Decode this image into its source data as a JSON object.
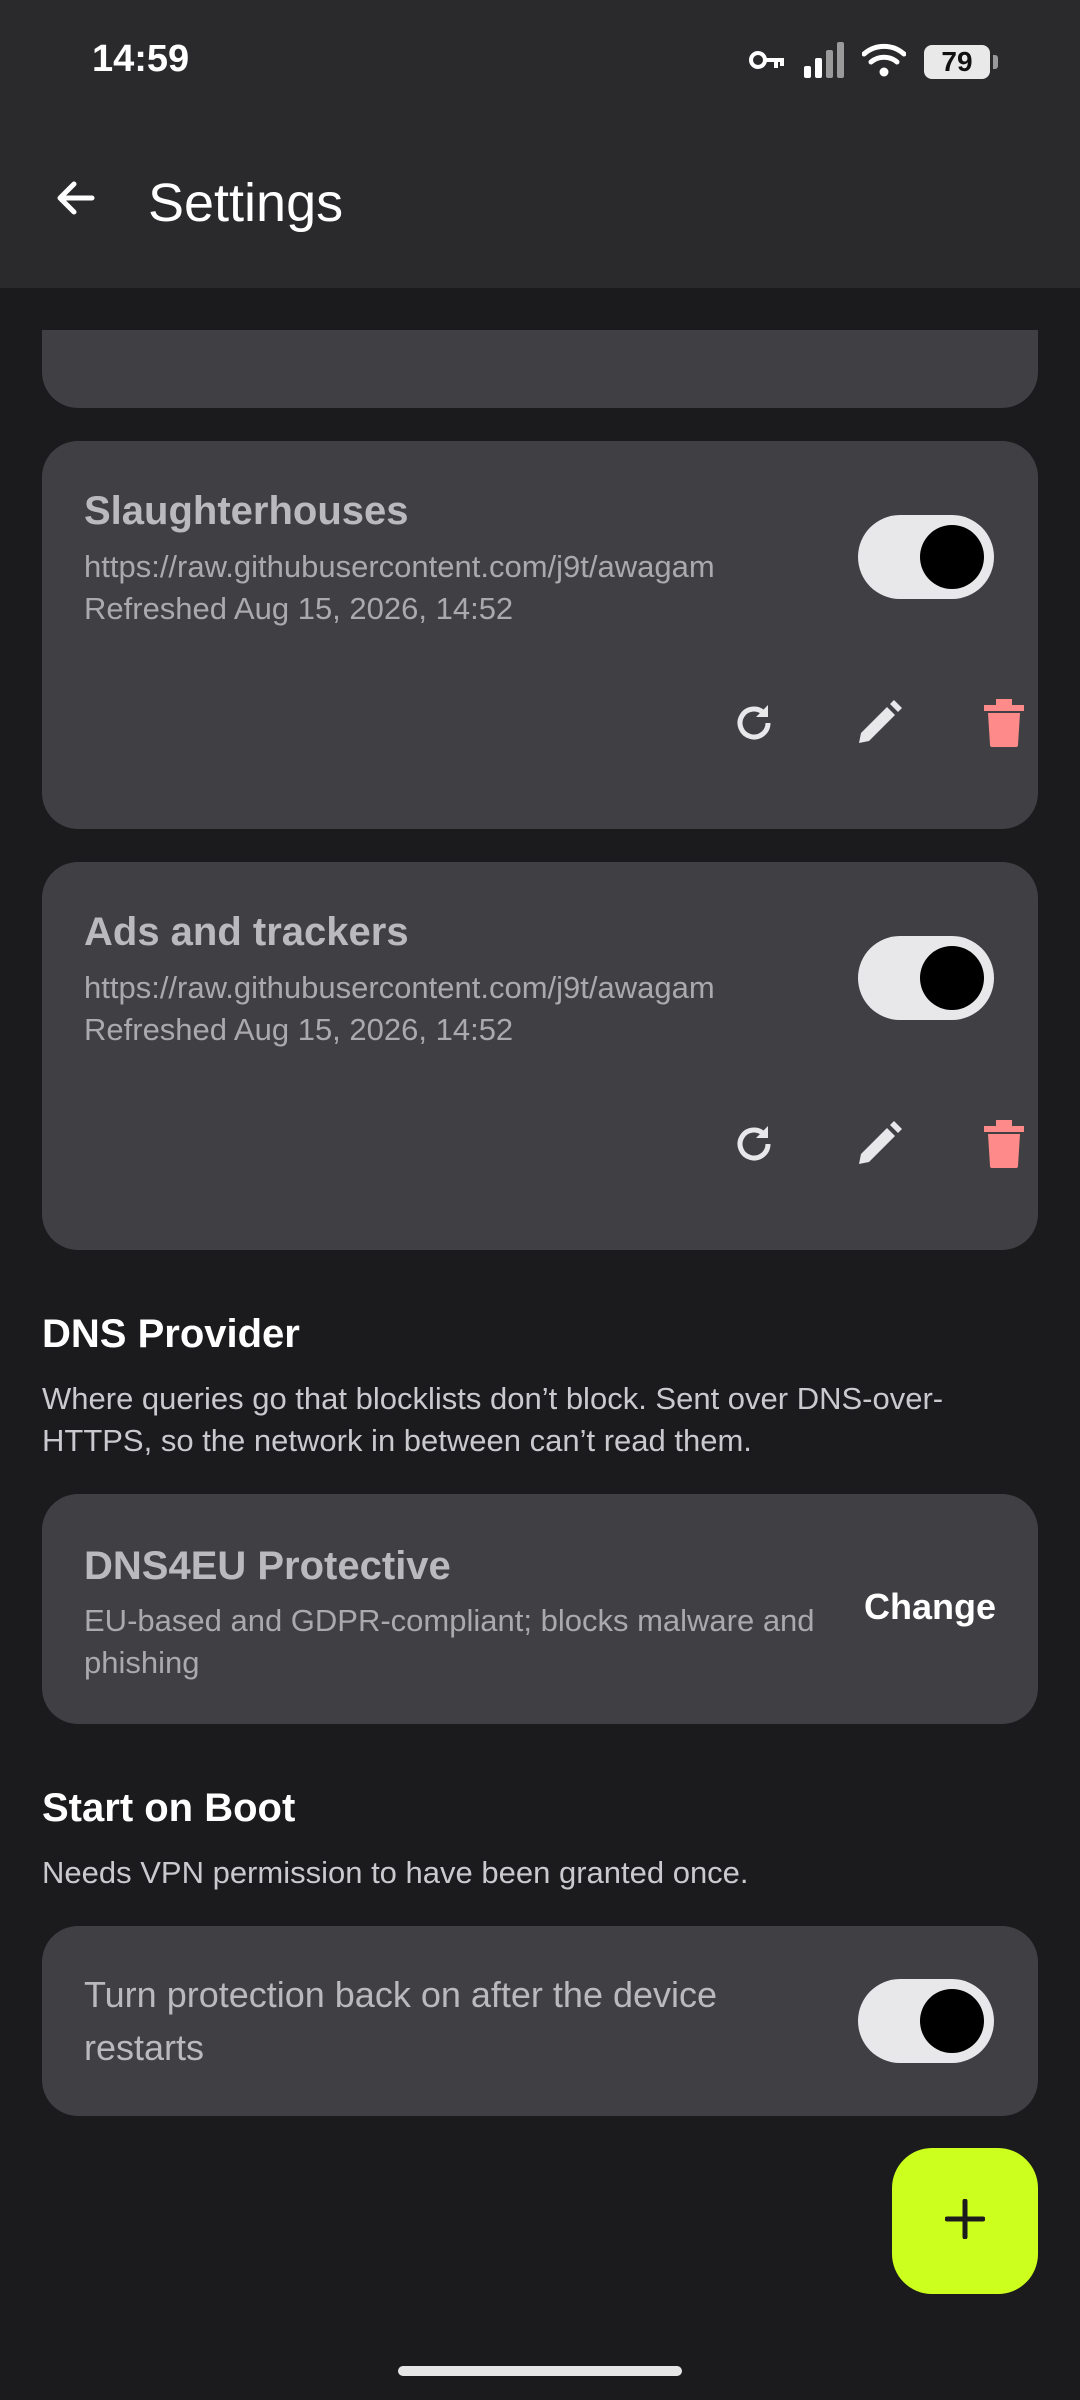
{
  "status_bar": {
    "time": "14:59",
    "battery": "79",
    "icons": [
      "vpn-key-icon",
      "signal-icon",
      "wifi-icon",
      "battery-icon"
    ]
  },
  "app_bar": {
    "title": "Settings",
    "back_icon": "arrow-left-icon"
  },
  "blocklists": [
    {
      "title": "Slaughterhouses",
      "url": "https://raw.githubusercontent.com/j9t/awagam",
      "refreshed": "Refreshed Aug 15, 2026, 14:52",
      "enabled": true
    },
    {
      "title": "Ads and trackers",
      "url": "https://raw.githubusercontent.com/j9t/awagam",
      "refreshed": "Refreshed Aug 15, 2026, 14:52",
      "enabled": true
    }
  ],
  "dns_provider": {
    "heading": "DNS Provider",
    "description": "Where queries go that blocklists don’t block. Sent over DNS-over-HTTPS, so the network in between can’t read them.",
    "current_name": "DNS4EU Protective",
    "current_description": "EU-based and GDPR-compliant; blocks malware and phishing",
    "change_label": "Change"
  },
  "start_on_boot": {
    "heading": "Start on Boot",
    "description": "Needs VPN permission to have been granted once.",
    "toggle_label": "Turn protection back on after the device restarts",
    "enabled": true
  },
  "fab": {
    "icon": "plus-icon"
  },
  "colors": {
    "background": "#1b1b1d",
    "card": "#3f3f44",
    "accent": "#ccff1e",
    "delete": "#ff8a8a"
  }
}
